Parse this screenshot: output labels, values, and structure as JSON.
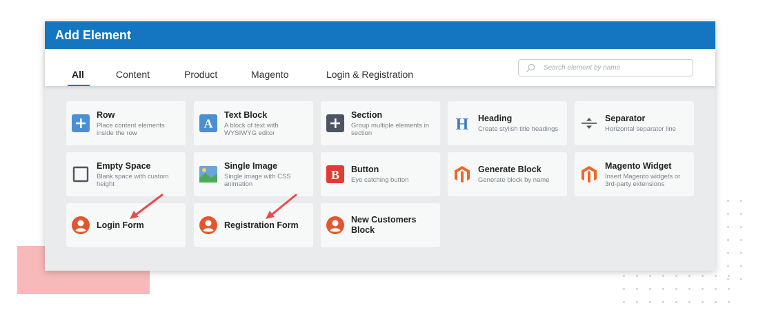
{
  "dialog": {
    "title": "Add Element"
  },
  "tabs": [
    {
      "label": "All",
      "active": true
    },
    {
      "label": "Content"
    },
    {
      "label": "Product"
    },
    {
      "label": "Magento"
    },
    {
      "label": "Login & Registration"
    }
  ],
  "search": {
    "placeholder": "Search element by name",
    "icon": "search-icon"
  },
  "elements": [
    {
      "name": "Row",
      "desc": "Place content elements inside the row",
      "icon": "plus-square-blue-icon"
    },
    {
      "name": "Text Block",
      "desc": "A block of text with WYSIWYG editor",
      "icon": "text-a-icon"
    },
    {
      "name": "Section",
      "desc": "Group multiple elements in section",
      "icon": "plus-square-dark-icon"
    },
    {
      "name": "Heading",
      "desc": "Create stylish title headings",
      "icon": "heading-h-icon"
    },
    {
      "name": "Separator",
      "desc": "Horizontal separator line",
      "icon": "separator-icon"
    },
    {
      "name": "Empty Space",
      "desc": "Blank space with custom height",
      "icon": "empty-square-icon"
    },
    {
      "name": "Single Image",
      "desc": "Single image with CSS animation",
      "icon": "image-icon"
    },
    {
      "name": "Button",
      "desc": "Eye catching button",
      "icon": "button-b-icon"
    },
    {
      "name": "Generate Block",
      "desc": "Generate block by name",
      "icon": "magento-icon"
    },
    {
      "name": "Magento Widget",
      "desc": "Insert Magento widgets or 3rd-party extensions",
      "icon": "magento-icon"
    },
    {
      "name": "Login Form",
      "desc": "",
      "icon": "user-avatar-icon"
    },
    {
      "name": "Registration Form",
      "desc": "",
      "icon": "user-avatar-icon"
    },
    {
      "name": "New Customers Block",
      "desc": "",
      "icon": "user-avatar-icon"
    }
  ],
  "colors": {
    "header": "#1476c1",
    "accent_red": "#e4572e",
    "arrow": "#e94b4b"
  }
}
